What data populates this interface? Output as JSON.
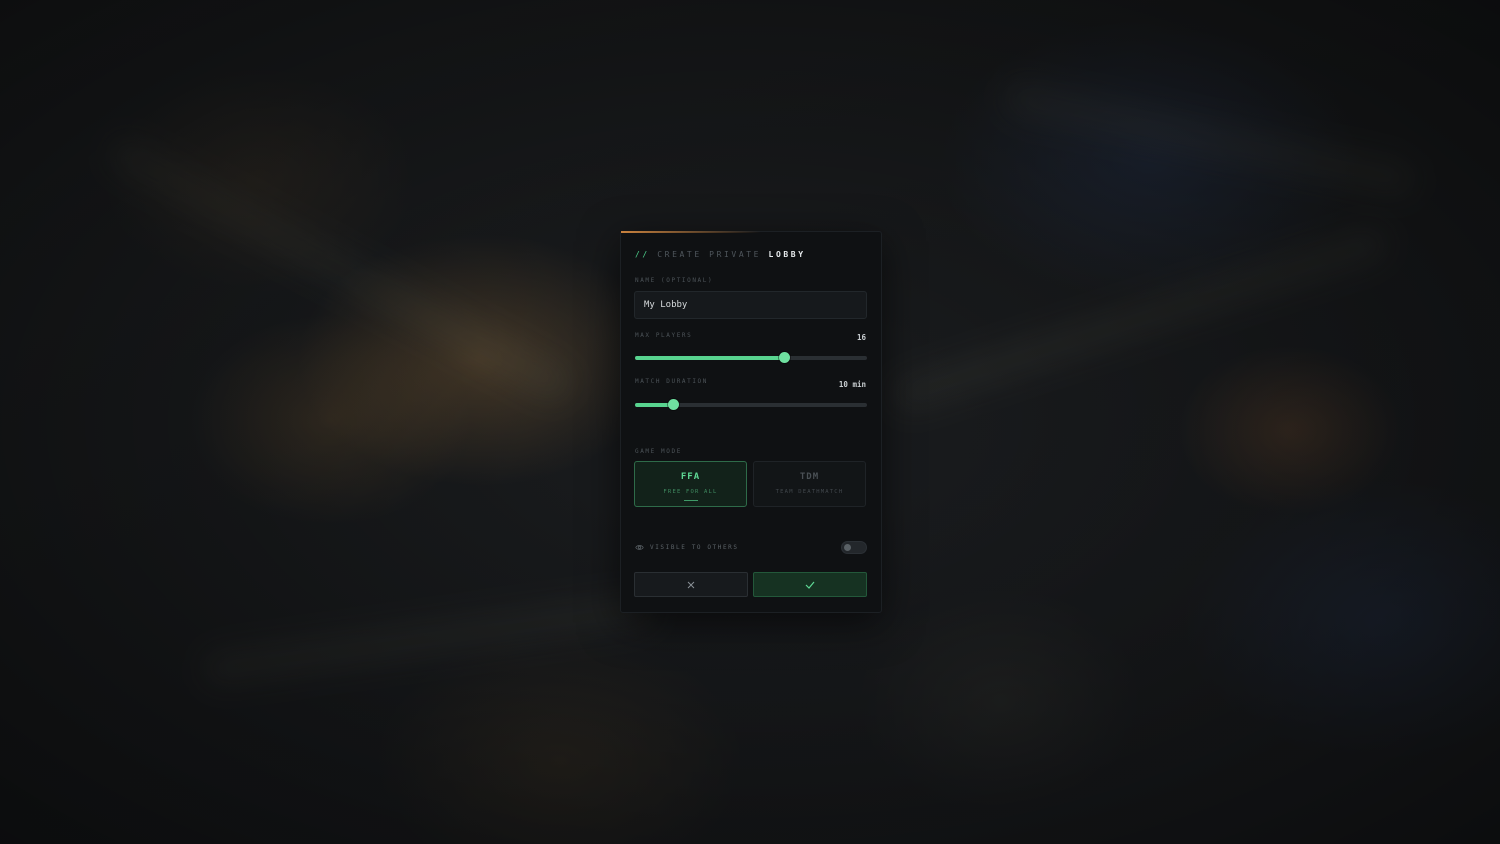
{
  "modal": {
    "title_prefix": "//",
    "title_main": "CREATE PRIVATE",
    "title_strong": "LOBBY"
  },
  "name": {
    "label": "NAME (OPTIONAL)",
    "value": "My Lobby"
  },
  "max_players": {
    "label": "MAX PLAYERS",
    "value": 16,
    "display": "16",
    "slider_fraction": 0.645
  },
  "match_duration": {
    "label": "MATCH DURATION",
    "value": 10,
    "display": "10 min",
    "slider_fraction": 0.165
  },
  "game_mode": {
    "label": "GAME MODE",
    "options": [
      {
        "code": "FFA",
        "desc": "FREE FOR ALL",
        "selected": true
      },
      {
        "code": "TDM",
        "desc": "TEAM DEATHMATCH",
        "selected": false
      }
    ]
  },
  "visibility": {
    "label": "VISIBLE TO OTHERS",
    "icon": "eye-icon",
    "enabled": false
  },
  "actions": {
    "cancel_icon": "close-icon",
    "confirm_icon": "check-icon"
  },
  "colors": {
    "accent_green": "#58d48f",
    "top_accent_orange": "#c9823e",
    "panel_bg": "#0f1113"
  }
}
